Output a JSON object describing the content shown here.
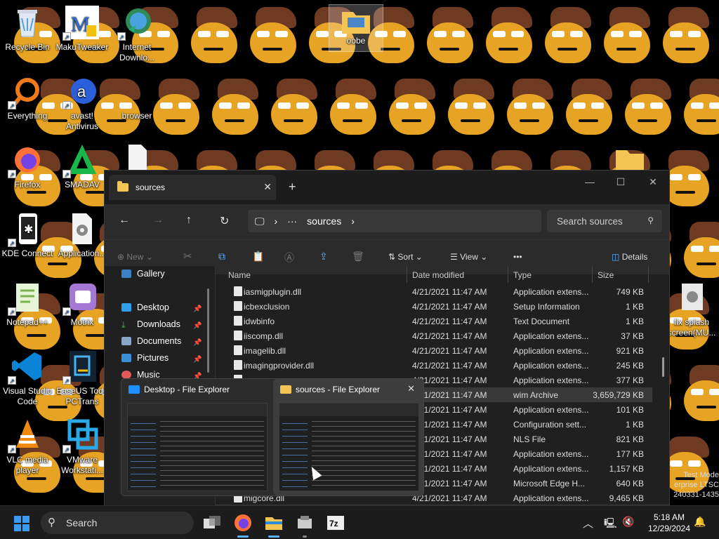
{
  "desktop": {
    "icons": [
      {
        "label": "Recycle Bin",
        "icon": "recycle-bin-icon"
      },
      {
        "label": "MakuTweaker",
        "icon": "makutweaker-icon"
      },
      {
        "label": "Internet Downlo...",
        "icon": "idm-icon"
      },
      {
        "label": "oobe",
        "icon": "folder-icon"
      },
      {
        "label": "Everything",
        "icon": "everything-icon"
      },
      {
        "label": "avast! Antivirus",
        "icon": "avast-icon"
      },
      {
        "label": "browser",
        "icon": "browser-icon"
      },
      {
        "label": "Firefox",
        "icon": "firefox-icon"
      },
      {
        "label": "SMADAV",
        "icon": "smadav-icon"
      },
      {
        "label": "KDE Connect",
        "icon": "kde-connect-icon"
      },
      {
        "label": "Application...",
        "icon": "application-icon"
      },
      {
        "label": "Notepad++",
        "icon": "notepadpp-icon"
      },
      {
        "label": "Motrix",
        "icon": "motrix-icon"
      },
      {
        "label": "Visual Studio Code",
        "icon": "vscode-icon"
      },
      {
        "label": "EaseUS Todo PCTrans",
        "icon": "easeus-icon"
      },
      {
        "label": "VLC media player",
        "icon": "vlc-icon"
      },
      {
        "label": "VMware Workstati...",
        "icon": "vmware-icon"
      },
      {
        "label": "fix splash screen(MU...",
        "icon": "settings-file-icon"
      }
    ],
    "watermark": "Test Mode\nerprise LTSC\n240331-1435"
  },
  "explorer": {
    "tab_title": "sources",
    "address": {
      "ellipsis": "···",
      "segment": "sources"
    },
    "search_placeholder": "Search sources",
    "commands": {
      "new": "New",
      "sort": "Sort",
      "view": "View",
      "more": "•••",
      "details": "Details"
    },
    "sidebar": [
      {
        "label": "Gallery",
        "icon": "gallery-icon",
        "pinned": false
      },
      {
        "label": "Desktop",
        "icon": "desktop-icon",
        "pinned": true
      },
      {
        "label": "Downloads",
        "icon": "downloads-icon",
        "pinned": true
      },
      {
        "label": "Documents",
        "icon": "documents-icon",
        "pinned": true
      },
      {
        "label": "Pictures",
        "icon": "pictures-icon",
        "pinned": true
      },
      {
        "label": "Music",
        "icon": "music-icon",
        "pinned": true
      }
    ],
    "columns": {
      "name": "Name",
      "date": "Date modified",
      "type": "Type",
      "size": "Size"
    },
    "files": [
      {
        "name": "iasmigplugin.dll",
        "date": "4/21/2021 11:47 AM",
        "type": "Application extens...",
        "size": "749 KB"
      },
      {
        "name": "icbexclusion",
        "date": "4/21/2021 11:47 AM",
        "type": "Setup Information",
        "size": "1 KB"
      },
      {
        "name": "idwbinfo",
        "date": "4/21/2021 11:47 AM",
        "type": "Text Document",
        "size": "1 KB"
      },
      {
        "name": "iiscomp.dll",
        "date": "4/21/2021 11:47 AM",
        "type": "Application extens...",
        "size": "37 KB"
      },
      {
        "name": "imagelib.dll",
        "date": "4/21/2021 11:47 AM",
        "type": "Application extens...",
        "size": "921 KB"
      },
      {
        "name": "imagingprovider.dll",
        "date": "4/21/2021 11:47 AM",
        "type": "Application extens...",
        "size": "245 KB"
      },
      {
        "name": "",
        "date": "4/21/2021 11:47 AM",
        "type": "Application extens...",
        "size": "377 KB"
      },
      {
        "name": "",
        "date": "4/21/2021 11:47 AM",
        "type": "wim Archive",
        "size": "3,659,729 KB"
      },
      {
        "name": "",
        "date": "4/21/2021 11:47 AM",
        "type": "Application extens...",
        "size": "101 KB"
      },
      {
        "name": "",
        "date": "4/21/2021 11:47 AM",
        "type": "Configuration sett...",
        "size": "1 KB"
      },
      {
        "name": "",
        "date": "4/21/2021 11:47 AM",
        "type": "NLS File",
        "size": "821 KB"
      },
      {
        "name": "",
        "date": "4/21/2021 11:47 AM",
        "type": "Application extens...",
        "size": "177 KB"
      },
      {
        "name": "",
        "date": "4/21/2021 11:47 AM",
        "type": "Application extens...",
        "size": "1,157 KB"
      },
      {
        "name": "",
        "date": "4/21/2021 11:47 AM",
        "type": "Microsoft Edge H...",
        "size": "640 KB"
      },
      {
        "name": "migcore.dll",
        "date": "4/21/2021 11:47 AM",
        "type": "Application extens...",
        "size": "9,465 KB"
      }
    ]
  },
  "thumbnails": [
    {
      "title": "Desktop - File Explorer"
    },
    {
      "title": "sources - File Explorer"
    }
  ],
  "taskbar": {
    "search_label": "Search",
    "time": "5:18 AM",
    "date": "12/29/2024"
  }
}
